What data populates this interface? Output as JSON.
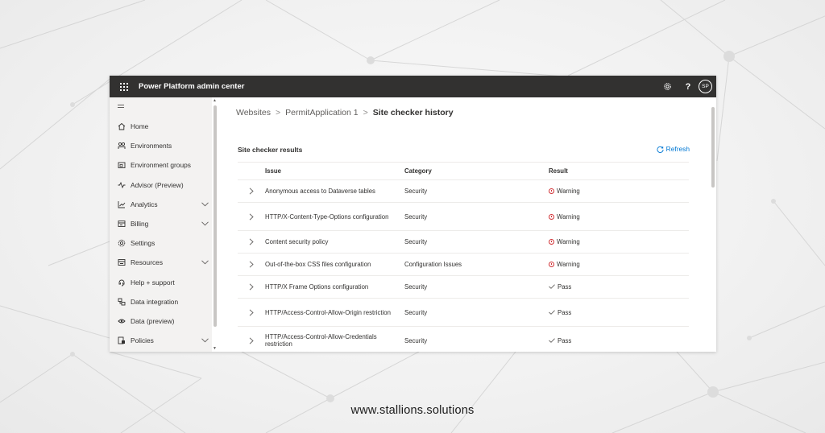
{
  "header": {
    "app_title": "Power Platform admin center",
    "help": "?",
    "avatar": "SP"
  },
  "sidebar": {
    "items": [
      {
        "label": "Home",
        "icon": "home-icon",
        "chevron": false
      },
      {
        "label": "Environments",
        "icon": "environments-icon",
        "chevron": false
      },
      {
        "label": "Environment groups",
        "icon": "environment-groups-icon",
        "chevron": false
      },
      {
        "label": "Advisor (Preview)",
        "icon": "advisor-icon",
        "chevron": false
      },
      {
        "label": "Analytics",
        "icon": "analytics-icon",
        "chevron": true
      },
      {
        "label": "Billing",
        "icon": "billing-icon",
        "chevron": true
      },
      {
        "label": "Settings",
        "icon": "settings-icon",
        "chevron": false
      },
      {
        "label": "Resources",
        "icon": "resources-icon",
        "chevron": true
      },
      {
        "label": "Help + support",
        "icon": "help-support-icon",
        "chevron": false
      },
      {
        "label": "Data integration",
        "icon": "data-integration-icon",
        "chevron": false
      },
      {
        "label": "Data (preview)",
        "icon": "data-preview-icon",
        "chevron": false
      },
      {
        "label": "Policies",
        "icon": "policies-icon",
        "chevron": true
      }
    ]
  },
  "breadcrumb": {
    "items": [
      "Websites",
      "PermitApplication 1"
    ],
    "current": "Site checker history",
    "separator": ">"
  },
  "results": {
    "title": "Site checker results",
    "refresh_label": "Refresh",
    "columns": [
      "Issue",
      "Category",
      "Result"
    ],
    "rows": [
      {
        "issue": "Anonymous access to Dataverse tables",
        "category": "Security",
        "result": "Warning"
      },
      {
        "issue": "HTTP/X-Content-Type-Options configuration",
        "category": "Security",
        "result": "Warning"
      },
      {
        "issue": "Content security policy",
        "category": "Security",
        "result": "Warning"
      },
      {
        "issue": "Out-of-the-box CSS files configuration",
        "category": "Configuration Issues",
        "result": "Warning"
      },
      {
        "issue": "HTTP/X Frame Options configuration",
        "category": "Security",
        "result": "Pass"
      },
      {
        "issue": "HTTP/Access-Control-Allow-Origin restriction",
        "category": "Security",
        "result": "Pass"
      },
      {
        "issue": "HTTP/Access-Control-Allow-Credentials restriction",
        "category": "Security",
        "result": "Pass"
      }
    ]
  },
  "colors": {
    "accent": "#0078d4",
    "topbar": "#323130",
    "warning": "#d13438"
  },
  "footer": {
    "url": "www.stallions.solutions"
  }
}
